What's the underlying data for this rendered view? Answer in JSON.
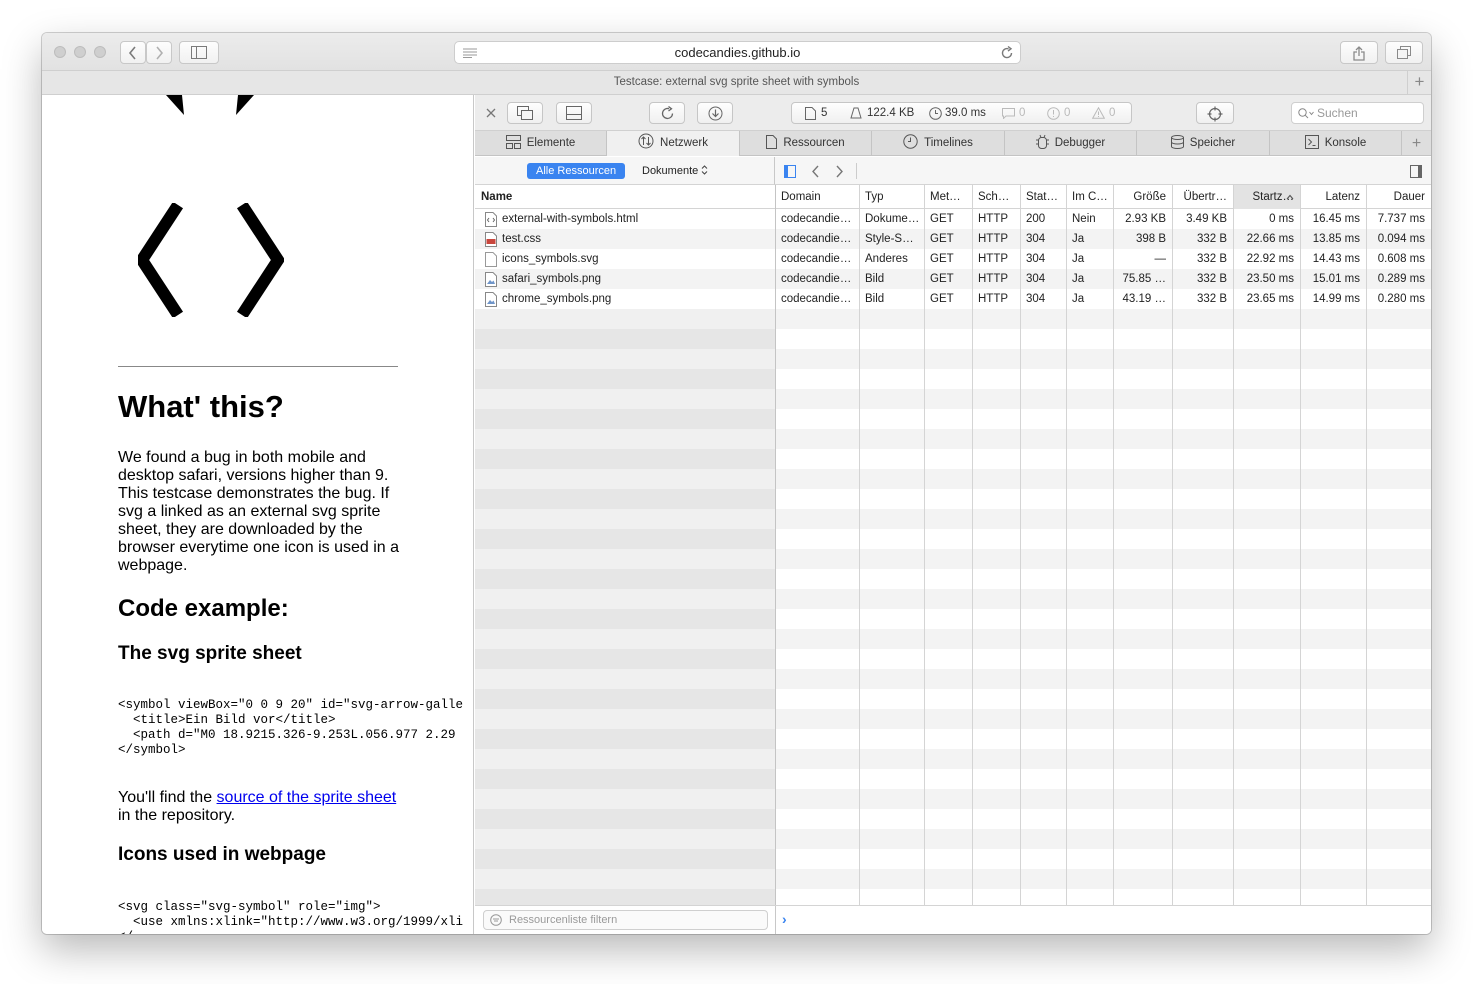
{
  "browser": {
    "url": "codecandies.github.io",
    "tab_title": "Testcase: external svg sprite sheet with symbols"
  },
  "page": {
    "heading": "What' this?",
    "intro": "We found a bug in both mobile and desktop safari, versions higher than 9. This testcase demonstrates the bug. If svg a linked as an external svg sprite sheet, they are downloaded by the browser everytime one icon is used in a webpage.",
    "code_example_heading": "Code example:",
    "sprite_heading": "The svg sprite sheet",
    "sprite_code": "<symbol viewBox=\"0 0 9 20\" id=\"svg-arrow-galle\n  <title>Ein Bild vor</title>\n  <path d=\"M0 18.9215.326-9.253L.056.977 2.29\n</symbol>",
    "source_text_before": "You'll find the ",
    "source_link": "source of the sprite sheet",
    "source_text_after": "in the repository.",
    "icons_heading": "Icons used in webpage",
    "icons_code": "<svg class=\"svg-symbol\" role=\"img\">\n  <use xmlns:xlink=\"http://www.w3.org/1999/xli\n</"
  },
  "devtools": {
    "stats": {
      "requests": "5",
      "size": "122.4 KB",
      "time": "39.0 ms",
      "logs": "0",
      "errors": "0",
      "warnings": "0"
    },
    "search_placeholder": "Suchen",
    "tabs": [
      {
        "label": "Elemente",
        "icon": "elements-icon"
      },
      {
        "label": "Netzwerk",
        "icon": "network-icon"
      },
      {
        "label": "Ressourcen",
        "icon": "resources-icon"
      },
      {
        "label": "Timelines",
        "icon": "timelines-icon"
      },
      {
        "label": "Debugger",
        "icon": "debugger-icon"
      },
      {
        "label": "Speicher",
        "icon": "storage-icon"
      },
      {
        "label": "Konsole",
        "icon": "console-icon"
      }
    ],
    "active_tab": "Netzwerk",
    "filter": {
      "all_resources": "Alle Ressourcen",
      "documents": "Dokumente"
    },
    "columns": [
      "Name",
      "Domain",
      "Typ",
      "Met…",
      "Sch…",
      "Stat…",
      "Im C…",
      "Größe",
      "Übertr…",
      "Startz…",
      "Latenz",
      "Dauer"
    ],
    "rows": [
      {
        "name": "external-with-symbols.html",
        "file_icon": "html-file-icon",
        "domain": "codecandie…",
        "type": "Dokume…",
        "method": "GET",
        "scheme": "HTTP",
        "status": "200",
        "cached": "Nein",
        "size": "2.93 KB",
        "transferred": "3.49 KB",
        "start": "0 ms",
        "latency": "16.45 ms",
        "duration": "7.737 ms"
      },
      {
        "name": "test.css",
        "file_icon": "css-file-icon",
        "domain": "codecandie…",
        "type": "Style-S…",
        "method": "GET",
        "scheme": "HTTP",
        "status": "304",
        "cached": "Ja",
        "size": "398 B",
        "transferred": "332 B",
        "start": "22.66 ms",
        "latency": "13.85 ms",
        "duration": "0.094 ms"
      },
      {
        "name": "icons_symbols.svg",
        "file_icon": "generic-file-icon",
        "domain": "codecandie…",
        "type": "Anderes",
        "method": "GET",
        "scheme": "HTTP",
        "status": "304",
        "cached": "Ja",
        "size": "—",
        "transferred": "332 B",
        "start": "22.92 ms",
        "latency": "14.43 ms",
        "duration": "0.608 ms"
      },
      {
        "name": "safari_symbols.png",
        "file_icon": "image-file-icon",
        "domain": "codecandie…",
        "type": "Bild",
        "method": "GET",
        "scheme": "HTTP",
        "status": "304",
        "cached": "Ja",
        "size": "75.85 …",
        "transferred": "332 B",
        "start": "23.50 ms",
        "latency": "15.01 ms",
        "duration": "0.289 ms"
      },
      {
        "name": "chrome_symbols.png",
        "file_icon": "image-file-icon",
        "domain": "codecandie…",
        "type": "Bild",
        "method": "GET",
        "scheme": "HTTP",
        "status": "304",
        "cached": "Ja",
        "size": "43.19 …",
        "transferred": "332 B",
        "start": "23.65 ms",
        "latency": "14.99 ms",
        "duration": "0.280 ms"
      }
    ],
    "resource_filter_placeholder": "Ressourcenliste filtern"
  },
  "colors": {
    "accent": "#3a84f0",
    "link": "#0000ee"
  }
}
